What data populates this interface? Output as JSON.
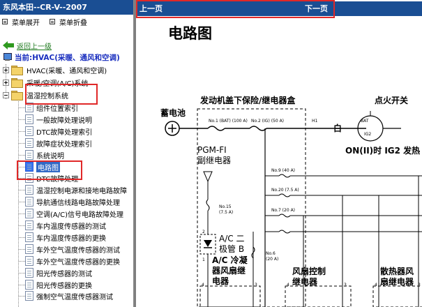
{
  "left_pane": {
    "title": "东风本田--CR-V--2007",
    "menu": {
      "expand": "菜单展开",
      "collapse": "菜单折叠"
    },
    "back_link": "返回上一级",
    "current": "当前:HVAC(采暖、通风和空调)",
    "tree": {
      "hvac": "HVAC(采暖、通风和空调)",
      "ac_system": "采暖/空调(A/C)系统",
      "climate_control": "温湿控制系统",
      "items": [
        "组件位置索引",
        "一般故障处理说明",
        "DTC故障处理索引",
        "故障症状处理索引",
        "系统说明",
        "电路图",
        "DTC故障处理",
        "温湿控制电源和接地电路故障",
        "导航通信线路电路故障处理",
        "空调(A/C)信号电路故障处理",
        "车内温度传感器的测试",
        "车内温度传感器的更换",
        "车外空气温度传感器的测试",
        "车外空气温度传感器的更换",
        "阳光传感器的测试",
        "阳光传感器的更换",
        "强制空气温度传感器测试"
      ]
    }
  },
  "right_pane": {
    "nav": {
      "prev": "上一页",
      "next": "下一页"
    },
    "page_title": "电路图",
    "diagram": {
      "fuse_box_label": "发动机盖下保险/继电器盒",
      "ignition_switch_label": "点火开关",
      "battery_label": "蓄电池",
      "fuse1": "No.1 (BAT) (100 A)",
      "fuse2": "No.2 (IG) (50 A)",
      "h1": "H1",
      "wire_white": "白",
      "bat": "BAT",
      "ig2": "IG2",
      "on_text": "ON(II)时 IG2 发热",
      "pgm_label_1": "PGM-FI",
      "pgm_label_2": "副继电器",
      "fuse9": "No.9 (40 A)",
      "fuse20": "No.20 (7.5 A)",
      "fuse7": "No.7 (20 A)",
      "fuse15_1": "No.15",
      "fuse15_2": "(7.5 A)",
      "ac_diode_1": "A/C 二",
      "ac_diode_2": "极管 B",
      "ac_comp_1": "A/C 冷凝",
      "ac_comp_2": "器风扇继",
      "ac_comp_3": "电器",
      "fuse6_1": "No.6",
      "fuse6_2": "(20 A)",
      "fan_ctrl_1": "风扇控制",
      "fan_ctrl_2": "继电器",
      "rad_fan_1": "散热器风",
      "rad_fan_2": "扇继电器",
      "pin2": "2",
      "pin1": "1",
      "pin4a": "4",
      "pin3a": "3",
      "pin4b": "4",
      "pin3b": "3",
      "pin4c": "4",
      "pin3c": "3"
    }
  }
}
